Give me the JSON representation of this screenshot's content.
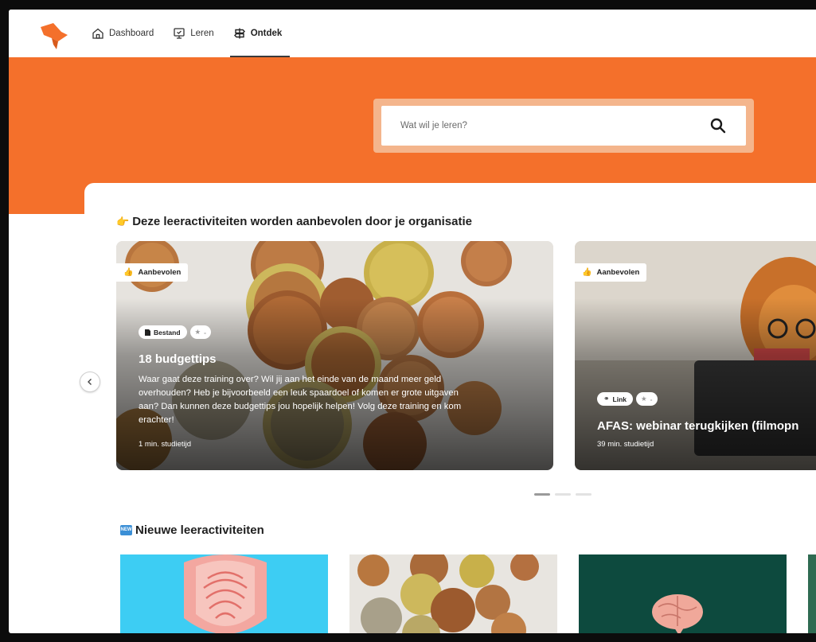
{
  "nav": {
    "items": [
      {
        "label": "Dashboard",
        "icon": "home-icon",
        "active": false
      },
      {
        "label": "Leren",
        "icon": "monitor-icon",
        "active": false
      },
      {
        "label": "Ontdek",
        "icon": "signpost-icon",
        "active": true
      }
    ]
  },
  "search": {
    "placeholder": "Wat wil je leren?",
    "icon": "search-icon"
  },
  "sections": {
    "recommended": {
      "emoji": "👉",
      "title": "Deze leeractiviteiten worden aanbevolen door je organisatie"
    },
    "new": {
      "emoji": "🆕",
      "title": "Nieuwe leeractiviteiten"
    }
  },
  "cards": [
    {
      "badge": "Aanbevolen",
      "type": "Bestand",
      "rating": "-",
      "title": "18 budgettips",
      "description": "Waar gaat deze training over? Wil jij aan het einde van de maand meer geld overhouden? Heb je bijvoorbeeld een leuk spaardoel of komen er grote uitgaven aan? Dan kunnen deze budgettips jou hopelijk helpen! Volg deze training en kom erachter!",
      "duration": "1 min. studietijd"
    },
    {
      "badge": "Aanbevolen",
      "type": "Link",
      "rating": "-",
      "title": "AFAS: webinar terugkijken (filmopn",
      "duration": "39 min. studietijd"
    }
  ],
  "carousel": {
    "pages": 3,
    "current": 1
  },
  "colors": {
    "brand": "#f4702b",
    "search_frame": "#f4b58c"
  }
}
